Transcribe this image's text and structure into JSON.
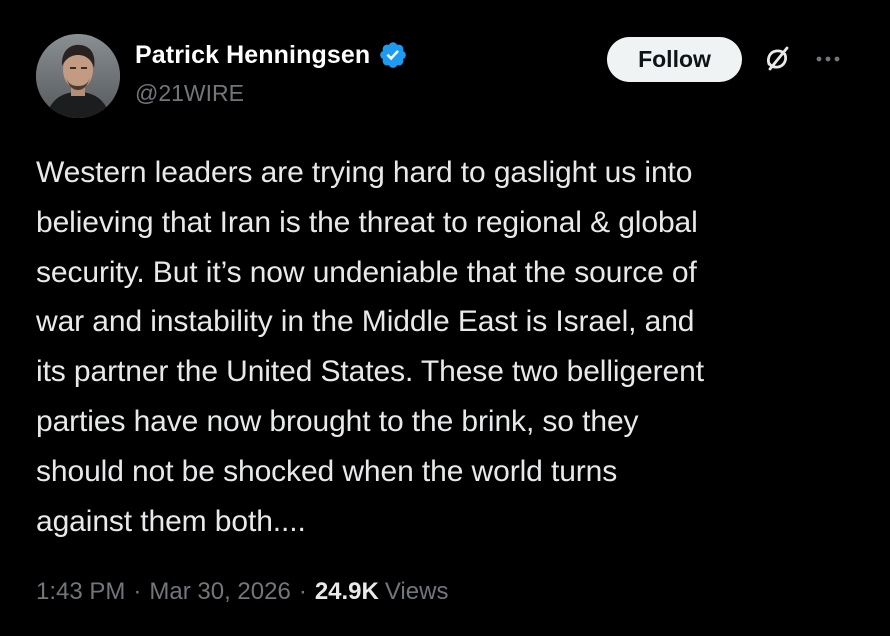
{
  "author": {
    "display_name": "Patrick Henningsen",
    "handle": "@21WIRE",
    "verified": true,
    "avatar_icon": "profile-photo"
  },
  "actions": {
    "follow_label": "Follow",
    "grok_icon": "grok-icon",
    "more_icon": "more-icon"
  },
  "tweet": {
    "text": "Western leaders are trying hard to gaslight us into\nbelieving that Iran is the threat to regional & global\nsecurity. But it’s now undeniable that the source of\nwar and instability in the Middle East is Israel, and\nits partner the United States. These two belligerent\nparties have now brought to the brink, so they\nshould not be shocked when the world turns\nagainst them both...."
  },
  "meta": {
    "time": "1:43 PM",
    "separator": "·",
    "date": "Mar 30, 2026",
    "views_count": "24.9K",
    "views_label": "Views"
  },
  "colors": {
    "background": "#000000",
    "text_primary": "#e7e9ea",
    "text_secondary": "#71767b",
    "verified_blue": "#1d9bf0",
    "follow_bg": "#eff3f4"
  }
}
